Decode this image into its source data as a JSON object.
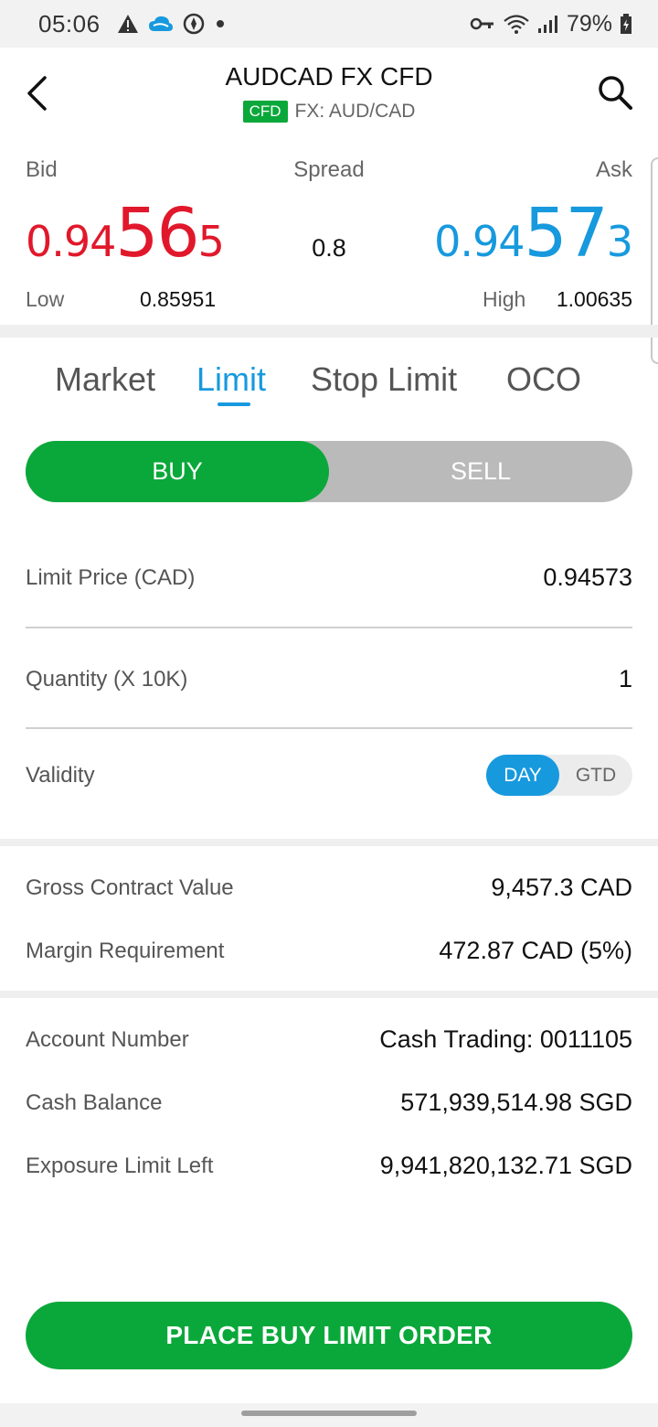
{
  "status_bar": {
    "time": "05:06",
    "battery": "79%",
    "icons": [
      "warning-icon",
      "cloud-icon",
      "compass-icon",
      "dot-icon",
      "vpn-key-icon",
      "wifi-icon",
      "signal-icon",
      "battery-charging-icon"
    ]
  },
  "header": {
    "title": "AUDCAD FX CFD",
    "badge": "CFD",
    "subtitle": "FX: AUD/CAD",
    "icons": [
      "back-icon",
      "search-icon"
    ]
  },
  "quote": {
    "bid_label": "Bid",
    "spread_label": "Spread",
    "ask_label": "Ask",
    "bid_price_prefix": "0.94",
    "bid_price_big": "56",
    "bid_price_suffix": "5",
    "spread_value": "0.8",
    "ask_price_prefix": "0.94",
    "ask_price_big": "57",
    "ask_price_suffix": "3",
    "low_label": "Low",
    "low_value": "0.85951",
    "high_label": "High",
    "high_value": "1.00635"
  },
  "tabs": [
    {
      "label": "Market",
      "active": false
    },
    {
      "label": "Limit",
      "active": true
    },
    {
      "label": "Stop Limit",
      "active": false
    },
    {
      "label": "OCO",
      "active": false
    }
  ],
  "side": {
    "buy_label": "BUY",
    "sell_label": "SELL",
    "selected": "BUY"
  },
  "order": {
    "limit_price_label": "Limit Price (CAD)",
    "limit_price_value": "0.94573",
    "quantity_label": "Quantity (X 10K)",
    "quantity_value": "1",
    "validity_label": "Validity",
    "validity_options": [
      "DAY",
      "GTD"
    ],
    "validity_selected": "DAY"
  },
  "summary": {
    "gross_label": "Gross Contract Value",
    "gross_value": "9,457.3 CAD",
    "margin_label": "Margin Requirement",
    "margin_value": "472.87 CAD (5%)"
  },
  "account": {
    "number_label": "Account Number",
    "number_value": "Cash Trading: 0011105",
    "cash_label": "Cash Balance",
    "cash_value": "571,939,514.98 SGD",
    "exposure_label": "Exposure Limit Left",
    "exposure_value": "9,941,820,132.71 SGD"
  },
  "action": {
    "place_label": "PLACE BUY LIMIT ORDER"
  },
  "colors": {
    "green": "#0aa83a",
    "red": "#e1182b",
    "blue": "#1799de"
  }
}
